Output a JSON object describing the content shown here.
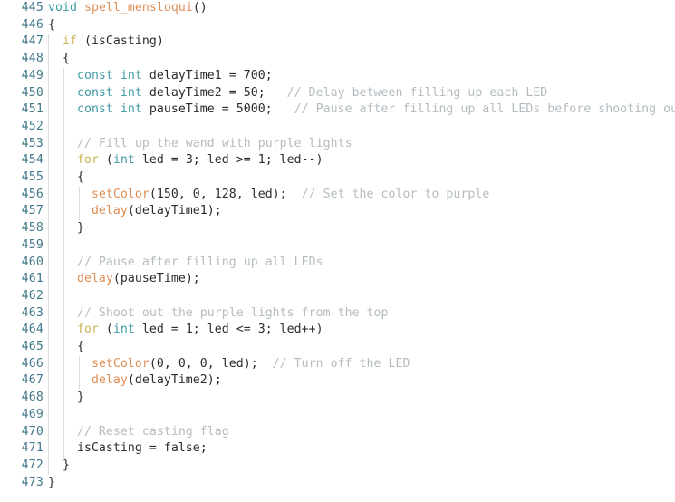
{
  "editor": {
    "name": "code-editor",
    "language": "cpp",
    "first_line_number": 445,
    "last_line_number": 473,
    "theme": {
      "background": "#ffffff",
      "gutter_text": "#41788a",
      "plain_text": "#2b2b2b",
      "keyword": "#c9b458",
      "type": "#3f9aa6",
      "function": "#df8e54",
      "comment": "#b4bcc0",
      "indent_guide": "#d6dde0"
    }
  },
  "lines": [
    {
      "number": "445",
      "indent": 0,
      "tokens": [
        {
          "t": "void",
          "c": "tok-type"
        },
        {
          "t": " ",
          "c": "tok-plain"
        },
        {
          "t": "spell_mensloqui",
          "c": "tok-fn"
        },
        {
          "t": "()",
          "c": "tok-plain"
        }
      ]
    },
    {
      "number": "446",
      "indent": 0,
      "tokens": [
        {
          "t": "{",
          "c": "tok-plain"
        }
      ]
    },
    {
      "number": "447",
      "indent": 1,
      "tokens": [
        {
          "t": "  ",
          "c": "tok-plain"
        },
        {
          "t": "if",
          "c": "tok-kw"
        },
        {
          "t": " (isCasting)",
          "c": "tok-plain"
        }
      ]
    },
    {
      "number": "448",
      "indent": 1,
      "tokens": [
        {
          "t": "  {",
          "c": "tok-plain"
        }
      ]
    },
    {
      "number": "449",
      "indent": 2,
      "tokens": [
        {
          "t": "    ",
          "c": "tok-plain"
        },
        {
          "t": "const int",
          "c": "tok-type"
        },
        {
          "t": " delayTime1 = 700;",
          "c": "tok-plain"
        }
      ]
    },
    {
      "number": "450",
      "indent": 2,
      "tokens": [
        {
          "t": "    ",
          "c": "tok-plain"
        },
        {
          "t": "const int",
          "c": "tok-type"
        },
        {
          "t": " delayTime2 = 50;   ",
          "c": "tok-plain"
        },
        {
          "t": "// Delay between filling up each LED",
          "c": "tok-comment"
        }
      ]
    },
    {
      "number": "451",
      "indent": 2,
      "tokens": [
        {
          "t": "    ",
          "c": "tok-plain"
        },
        {
          "t": "const int",
          "c": "tok-type"
        },
        {
          "t": " pauseTime = 5000;   ",
          "c": "tok-plain"
        },
        {
          "t": "// Pause after filling up all LEDs before shooting out",
          "c": "tok-comment"
        }
      ]
    },
    {
      "number": "452",
      "indent": 2,
      "tokens": []
    },
    {
      "number": "453",
      "indent": 2,
      "tokens": [
        {
          "t": "    ",
          "c": "tok-plain"
        },
        {
          "t": "// Fill up the wand with purple lights",
          "c": "tok-comment"
        }
      ]
    },
    {
      "number": "454",
      "indent": 2,
      "tokens": [
        {
          "t": "    ",
          "c": "tok-plain"
        },
        {
          "t": "for",
          "c": "tok-kw"
        },
        {
          "t": " (",
          "c": "tok-plain"
        },
        {
          "t": "int",
          "c": "tok-type"
        },
        {
          "t": " led = 3; led >= 1; led--)",
          "c": "tok-plain"
        }
      ]
    },
    {
      "number": "455",
      "indent": 2,
      "tokens": [
        {
          "t": "    {",
          "c": "tok-plain"
        }
      ]
    },
    {
      "number": "456",
      "indent": 3,
      "tokens": [
        {
          "t": "      ",
          "c": "tok-plain"
        },
        {
          "t": "setColor",
          "c": "tok-fn"
        },
        {
          "t": "(150, 0, 128, led);  ",
          "c": "tok-plain"
        },
        {
          "t": "// Set the color to purple",
          "c": "tok-comment"
        }
      ]
    },
    {
      "number": "457",
      "indent": 3,
      "tokens": [
        {
          "t": "      ",
          "c": "tok-plain"
        },
        {
          "t": "delay",
          "c": "tok-fn"
        },
        {
          "t": "(delayTime1);",
          "c": "tok-plain"
        }
      ]
    },
    {
      "number": "458",
      "indent": 2,
      "tokens": [
        {
          "t": "    }",
          "c": "tok-plain"
        }
      ]
    },
    {
      "number": "459",
      "indent": 2,
      "tokens": []
    },
    {
      "number": "460",
      "indent": 2,
      "tokens": [
        {
          "t": "    ",
          "c": "tok-plain"
        },
        {
          "t": "// Pause after filling up all LEDs",
          "c": "tok-comment"
        }
      ]
    },
    {
      "number": "461",
      "indent": 2,
      "tokens": [
        {
          "t": "    ",
          "c": "tok-plain"
        },
        {
          "t": "delay",
          "c": "tok-fn"
        },
        {
          "t": "(pauseTime);",
          "c": "tok-plain"
        }
      ]
    },
    {
      "number": "462",
      "indent": 2,
      "tokens": []
    },
    {
      "number": "463",
      "indent": 2,
      "tokens": [
        {
          "t": "    ",
          "c": "tok-plain"
        },
        {
          "t": "// Shoot out the purple lights from the top",
          "c": "tok-comment"
        }
      ]
    },
    {
      "number": "464",
      "indent": 2,
      "tokens": [
        {
          "t": "    ",
          "c": "tok-plain"
        },
        {
          "t": "for",
          "c": "tok-kw"
        },
        {
          "t": " (",
          "c": "tok-plain"
        },
        {
          "t": "int",
          "c": "tok-type"
        },
        {
          "t": " led = 1; led <= 3; led++)",
          "c": "tok-plain"
        }
      ]
    },
    {
      "number": "465",
      "indent": 2,
      "tokens": [
        {
          "t": "    {",
          "c": "tok-plain"
        }
      ]
    },
    {
      "number": "466",
      "indent": 3,
      "tokens": [
        {
          "t": "      ",
          "c": "tok-plain"
        },
        {
          "t": "setColor",
          "c": "tok-fn"
        },
        {
          "t": "(0, 0, 0, led);  ",
          "c": "tok-plain"
        },
        {
          "t": "// Turn off the LED",
          "c": "tok-comment"
        }
      ]
    },
    {
      "number": "467",
      "indent": 3,
      "tokens": [
        {
          "t": "      ",
          "c": "tok-plain"
        },
        {
          "t": "delay",
          "c": "tok-fn"
        },
        {
          "t": "(delayTime2);",
          "c": "tok-plain"
        }
      ]
    },
    {
      "number": "468",
      "indent": 2,
      "tokens": [
        {
          "t": "    }",
          "c": "tok-plain"
        }
      ]
    },
    {
      "number": "469",
      "indent": 2,
      "tokens": []
    },
    {
      "number": "470",
      "indent": 2,
      "tokens": [
        {
          "t": "    ",
          "c": "tok-plain"
        },
        {
          "t": "// Reset casting flag",
          "c": "tok-comment"
        }
      ]
    },
    {
      "number": "471",
      "indent": 2,
      "tokens": [
        {
          "t": "    isCasting = false;",
          "c": "tok-plain"
        }
      ]
    },
    {
      "number": "472",
      "indent": 1,
      "tokens": [
        {
          "t": "  }",
          "c": "tok-plain"
        }
      ]
    },
    {
      "number": "473",
      "indent": 0,
      "tokens": [
        {
          "t": "}",
          "c": "tok-plain"
        }
      ]
    }
  ]
}
